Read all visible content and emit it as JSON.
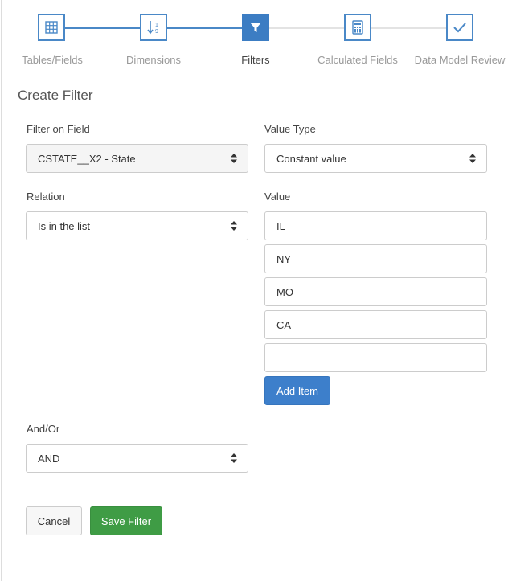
{
  "stepper": {
    "steps": [
      {
        "label": "Tables/Fields",
        "icon": "table-grid-icon",
        "state": "done"
      },
      {
        "label": "Dimensions",
        "icon": "sort-numeric-icon",
        "state": "done"
      },
      {
        "label": "Filters",
        "icon": "funnel-icon",
        "state": "active"
      },
      {
        "label": "Calculated Fields",
        "icon": "calculator-icon",
        "state": "pending"
      },
      {
        "label": "Data Model Review",
        "icon": "checkmark-icon",
        "state": "pending"
      }
    ]
  },
  "form": {
    "title": "Create Filter",
    "filter_field": {
      "label": "Filter on Field",
      "value": "CSTATE__X2 - State"
    },
    "value_type": {
      "label": "Value Type",
      "value": "Constant value"
    },
    "relation": {
      "label": "Relation",
      "value": "Is in the list"
    },
    "value": {
      "label": "Value",
      "items": [
        "IL",
        "NY",
        "MO",
        "CA",
        ""
      ],
      "add_label": "Add Item"
    },
    "and_or": {
      "label": "And/Or",
      "value": "AND"
    },
    "cancel_label": "Cancel",
    "save_label": "Save Filter"
  },
  "colors": {
    "accent": "#3c7dc3",
    "success": "#3f9c45",
    "line_done": "#4a88c7",
    "line_pending": "#e3e3e3"
  }
}
